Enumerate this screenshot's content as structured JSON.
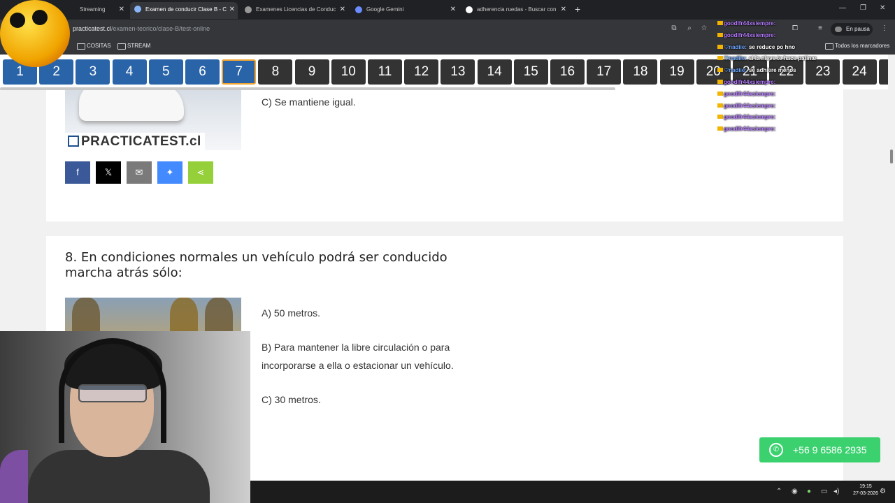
{
  "browser": {
    "tabs": [
      {
        "title": "Streaming"
      },
      {
        "title": "Examen de conducir Clase B - C"
      },
      {
        "title": "Examenes Licencias de Conduc"
      },
      {
        "title": "Google Gemini"
      },
      {
        "title": "adherencia ruedas - Buscar con"
      }
    ],
    "url_host": "practicatest.cl",
    "url_path": "/examen-teorico/clase-B/test-online",
    "profile_status": "En pausa",
    "bookmarks": [
      "COSITAS",
      "STREAM"
    ],
    "all_bookmarks": "Todos los marcadores"
  },
  "question_nav": {
    "numbers": [
      "1",
      "2",
      "3",
      "4",
      "5",
      "6",
      "7",
      "8",
      "9",
      "10",
      "11",
      "12",
      "13",
      "14",
      "15",
      "16",
      "17",
      "18",
      "19",
      "20",
      "21",
      "22",
      "23",
      "24",
      "2"
    ],
    "current": "7"
  },
  "prev_question": {
    "logo_text": "PRACTICATEST.cl",
    "option_c": "C) Se mantiene igual.",
    "share": [
      {
        "icon": "facebook-icon",
        "glyph": "f",
        "color": "#3b5998"
      },
      {
        "icon": "x-icon",
        "glyph": "𝕏",
        "color": "#000000"
      },
      {
        "icon": "email-icon",
        "glyph": "✉",
        "color": "#7a7a7a"
      },
      {
        "icon": "messenger-icon",
        "glyph": "✦",
        "color": "#448aff"
      },
      {
        "icon": "share-icon",
        "glyph": "⋖",
        "color": "#95d03a"
      }
    ]
  },
  "question8": {
    "title": "8. En condiciones normales un vehículo podrá ser conducido marcha atrás sólo:",
    "option_a": "A) 50 metros.",
    "option_b": "B) Para mantener la libre circulación o para incorporarse a ella o estacionar un vehículo.",
    "option_c": "C) 30 metros."
  },
  "whatsapp": {
    "phone": "+56 9 6586 2935"
  },
  "chat": [
    {
      "user": "goodlfr44xsiempre:",
      "msg": "",
      "color": "purple"
    },
    {
      "user": "goodlfr44xsiempre:",
      "msg": "",
      "color": "purple"
    },
    {
      "user": "♡nadiie:",
      "msg": "se reduce po hno",
      "color": "blue"
    },
    {
      "user": "♡nadiie:",
      "msg": "si la nieve te hace patinar",
      "color": "blue"
    },
    {
      "user": "♡nadiie:",
      "msg": "se adhiere menos",
      "color": "blue"
    },
    {
      "user": "goodlfr44xsiempre:",
      "msg": "",
      "color": "purple"
    },
    {
      "user": "goodlfr44xsiempre:",
      "msg": "",
      "color": "purple"
    },
    {
      "user": "goodlfr44xsiempre:",
      "msg": "",
      "color": "purple"
    },
    {
      "user": "goodlfr44xsiempre:",
      "msg": "",
      "color": "purple"
    },
    {
      "user": "goodlfr44xsiempre:",
      "msg": "",
      "color": "purple"
    }
  ],
  "taskbar": {
    "time": "19:15",
    "date": "27-03-2026"
  }
}
